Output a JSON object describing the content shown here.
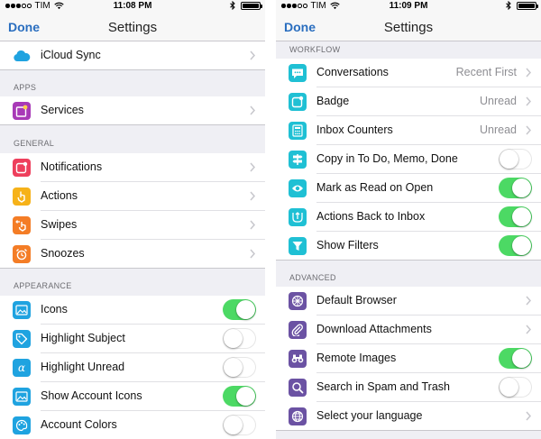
{
  "status_bar": {
    "carrier": "TIM",
    "time_left": "11:08 PM",
    "time_right": "11:09 PM"
  },
  "navbar": {
    "done_label": "Done",
    "title": "Settings"
  },
  "colors": {
    "accent": "#2a6ebf",
    "toggle_on": "#4cd964",
    "blue_icon": "#1fa3e0",
    "purple_icon": "#a83ab7",
    "red_icon": "#ee3f5c",
    "yellow_icon": "#f6b219",
    "orange_icon": "#f47d26",
    "teal_icon": "#1fc0d4",
    "violet_icon": "#6b52a3"
  },
  "left": {
    "top_row": {
      "label": "iCloud Sync",
      "icon": "cloud-icon"
    },
    "apps": {
      "header": "APPS",
      "items": [
        {
          "label": "Services",
          "icon": "services-icon"
        }
      ]
    },
    "general": {
      "header": "GENERAL",
      "items": [
        {
          "label": "Notifications",
          "icon": "notification-icon"
        },
        {
          "label": "Actions",
          "icon": "hand-tap-icon"
        },
        {
          "label": "Swipes",
          "icon": "swipe-hand-icon"
        },
        {
          "label": "Snoozes",
          "icon": "alarm-clock-icon"
        }
      ]
    },
    "appearance": {
      "header": "APPEARANCE",
      "items": [
        {
          "label": "Icons",
          "icon": "image-icon",
          "toggle": true
        },
        {
          "label": "Highlight Subject",
          "icon": "tag-icon",
          "toggle": false
        },
        {
          "label": "Highlight Unread",
          "icon": "alpha-icon",
          "toggle": false
        },
        {
          "label": "Show Account Icons",
          "icon": "image-icon",
          "toggle": true
        },
        {
          "label": "Account Colors",
          "icon": "palette-icon",
          "toggle": false
        }
      ]
    }
  },
  "right": {
    "workflow": {
      "header": "WORKFLOW",
      "items": [
        {
          "label": "Conversations",
          "value": "Recent First",
          "icon": "chat-bubble-icon"
        },
        {
          "label": "Badge",
          "value": "Unread",
          "icon": "badge-icon"
        },
        {
          "label": "Inbox Counters",
          "value": "Unread",
          "icon": "calculator-icon"
        },
        {
          "label": "Copy in To Do, Memo, Done",
          "icon": "signpost-icon",
          "toggle": false
        },
        {
          "label": "Mark as Read on Open",
          "icon": "eye-icon",
          "toggle": true
        },
        {
          "label": "Actions Back to Inbox",
          "icon": "return-arrow-icon",
          "toggle": true
        },
        {
          "label": "Show Filters",
          "icon": "filter-icon",
          "toggle": true
        }
      ]
    },
    "advanced": {
      "header": "ADVANCED",
      "items": [
        {
          "label": "Default Browser",
          "icon": "compass-icon"
        },
        {
          "label": "Download Attachments",
          "icon": "paperclip-icon"
        },
        {
          "label": "Remote Images",
          "icon": "binoculars-icon",
          "toggle": true
        },
        {
          "label": "Search in Spam and Trash",
          "icon": "magnifier-icon",
          "toggle": false
        },
        {
          "label": "Select your language",
          "icon": "globe-icon"
        }
      ]
    }
  }
}
